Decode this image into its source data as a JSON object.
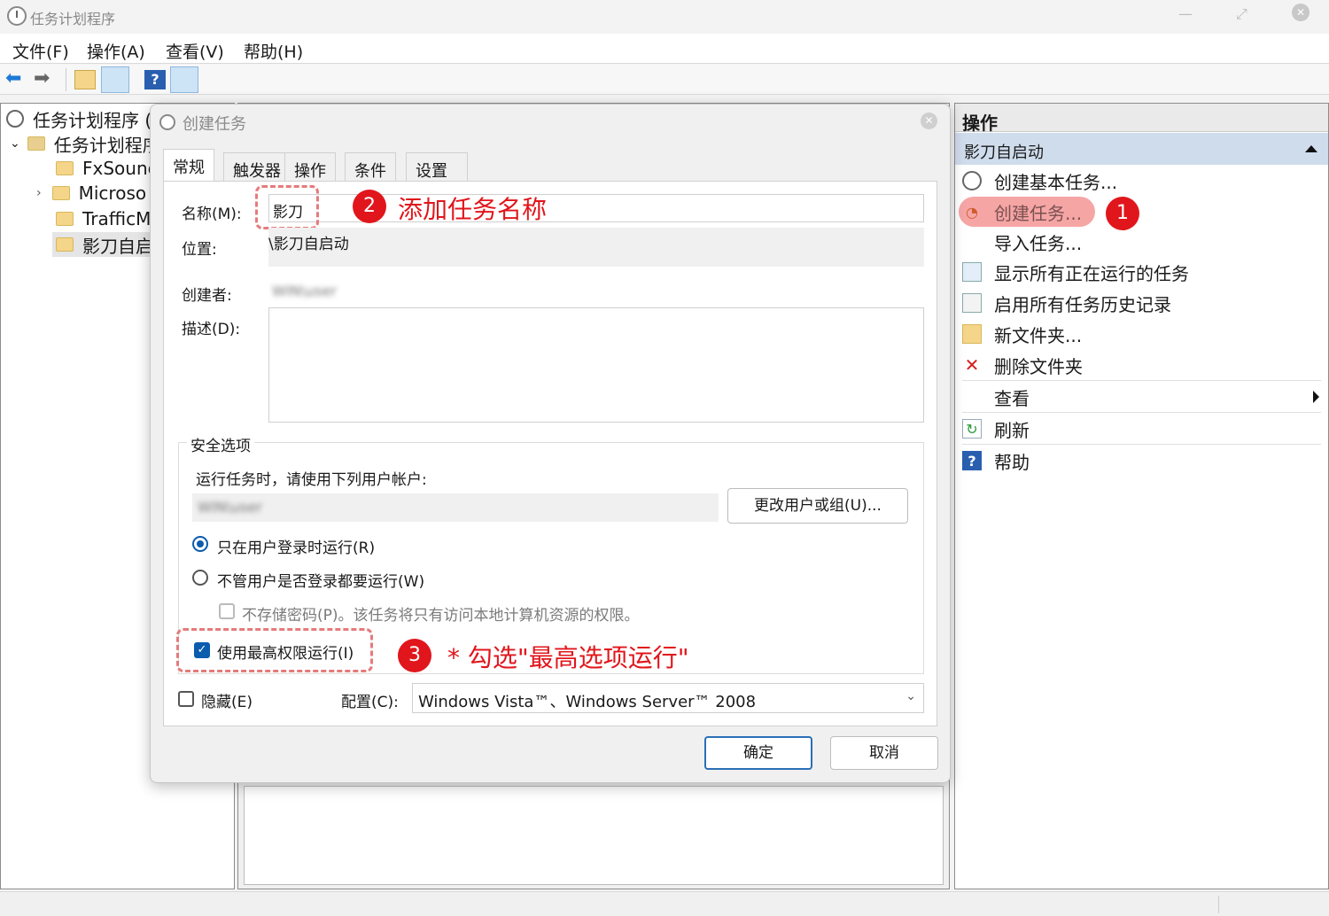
{
  "window": {
    "title": "任务计划程序"
  },
  "menu": [
    "文件(F)",
    "操作(A)",
    "查看(V)",
    "帮助(H)"
  ],
  "tree": {
    "root": "任务计划程序 (",
    "library": "任务计划程序",
    "items": [
      "FxSound",
      "Microso",
      "TrafficM",
      "影刀自启"
    ]
  },
  "actions": {
    "header": "操作",
    "section": "影刀自启动",
    "items": [
      {
        "label": "创建基本任务...",
        "icon": "create-basic-task-icon"
      },
      {
        "label": "创建任务...",
        "icon": "create-task-icon"
      },
      {
        "label": "导入任务...",
        "icon": ""
      },
      {
        "label": "显示所有正在运行的任务",
        "icon": "running-tasks-icon"
      },
      {
        "label": "启用所有任务历史记录",
        "icon": "history-icon"
      },
      {
        "label": "新文件夹...",
        "icon": "folder-icon"
      },
      {
        "label": "删除文件夹",
        "icon": "delete-icon"
      },
      {
        "label": "查看",
        "icon": ""
      },
      {
        "label": "刷新",
        "icon": "refresh-icon"
      },
      {
        "label": "帮助",
        "icon": "help-icon"
      }
    ]
  },
  "dialog": {
    "title": "创建任务",
    "tabs": [
      "常规",
      "触发器",
      "操作",
      "条件",
      "设置"
    ],
    "name_label": "名称(M):",
    "name_value": "影刀",
    "location_label": "位置:",
    "location_value": "\\影刀自启动",
    "author_label": "创建者:",
    "author_value": "WIN\\user",
    "description_label": "描述(D):",
    "security": {
      "group_label": "安全选项",
      "account_prompt": "运行任务时，请使用下列用户帐户:",
      "account_value": "WIN\\user",
      "change_user_button": "更改用户或组(U)...",
      "option_logged_on": "只在用户登录时运行(R)",
      "option_any": "不管用户是否登录都要运行(W)",
      "no_store_password": "不存储密码(P)。该任务将只有访问本地计算机资源的权限。",
      "highest_privileges": "使用最高权限运行(I)"
    },
    "hidden_label": "隐藏(E)",
    "config_label": "配置(C):",
    "config_value": "Windows Vista™、Windows Server™ 2008",
    "ok_button": "确定",
    "cancel_button": "取消"
  },
  "annotations": {
    "badge1": "1",
    "badge2": "2",
    "badge2_text": "添加任务名称",
    "badge3": "3",
    "badge3_text": "* 勾选\"最高选项运行\""
  },
  "colors": {
    "accent": "#0b5cad",
    "annotation": "#e0161c",
    "selected_section": "#cfdcec"
  }
}
